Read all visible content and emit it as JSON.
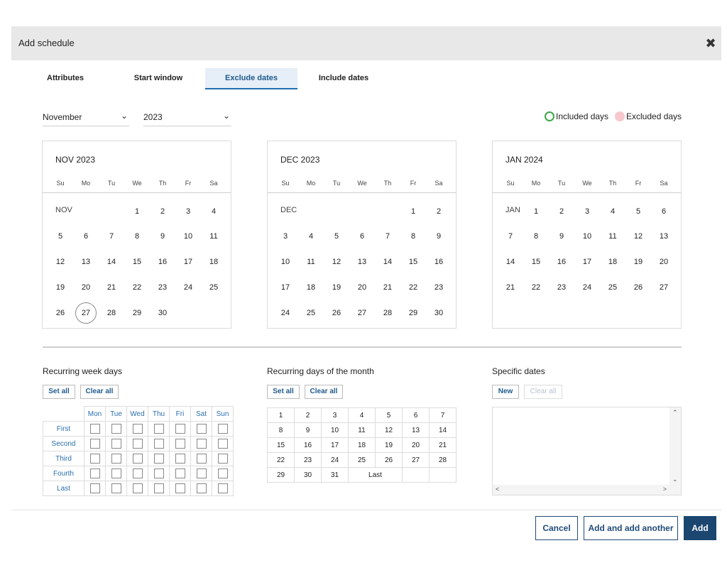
{
  "dialog": {
    "title": "Add schedule",
    "close_icon": "close-icon"
  },
  "tabs": [
    {
      "label": "Attributes",
      "active": false
    },
    {
      "label": "Start window",
      "active": false
    },
    {
      "label": "Exclude dates",
      "active": true
    },
    {
      "label": "Include dates",
      "active": false
    }
  ],
  "selectors": {
    "month": "November",
    "year": "2023"
  },
  "legend": {
    "included": "Included days",
    "excluded": "Excluded days",
    "included_color": "#3aa845",
    "excluded_color": "#f6c7cc"
  },
  "weekdays_short": [
    "Su",
    "Mo",
    "Tu",
    "We",
    "Th",
    "Fr",
    "Sa"
  ],
  "calendars": [
    {
      "title": "NOV 2023",
      "month_abbr": "NOV",
      "lead_blanks": 3,
      "days_in_month": 30,
      "today": 27
    },
    {
      "title": "DEC 2023",
      "month_abbr": "DEC",
      "lead_blanks": 5,
      "days_in_month": 30,
      "today": null
    },
    {
      "title": "JAN 2024",
      "month_abbr": "JAN",
      "lead_blanks": 1,
      "days_in_month": 27,
      "today": null
    }
  ],
  "recurring_week_days": {
    "title": "Recurring week days",
    "set_all": "Set all",
    "clear_all": "Clear all",
    "columns": [
      "Mon",
      "Tue",
      "Wed",
      "Thu",
      "Fri",
      "Sat",
      "Sun"
    ],
    "rows": [
      "First",
      "Second",
      "Third",
      "Fourth",
      "Last"
    ]
  },
  "recurring_month_days": {
    "title": "Recurring days of the month",
    "set_all": "Set all",
    "clear_all": "Clear all",
    "rows": [
      [
        "1",
        "2",
        "3",
        "4",
        "5",
        "6",
        "7"
      ],
      [
        "8",
        "9",
        "10",
        "11",
        "12",
        "13",
        "14"
      ],
      [
        "15",
        "16",
        "17",
        "18",
        "19",
        "20",
        "21"
      ],
      [
        "22",
        "23",
        "24",
        "25",
        "26",
        "27",
        "28"
      ],
      [
        "29",
        "30",
        "31",
        "Last"
      ]
    ]
  },
  "specific_dates": {
    "title": "Specific dates",
    "new": "New",
    "clear_all": "Clear all"
  },
  "footer": {
    "cancel": "Cancel",
    "add_another": "Add and add another",
    "add": "Add"
  }
}
